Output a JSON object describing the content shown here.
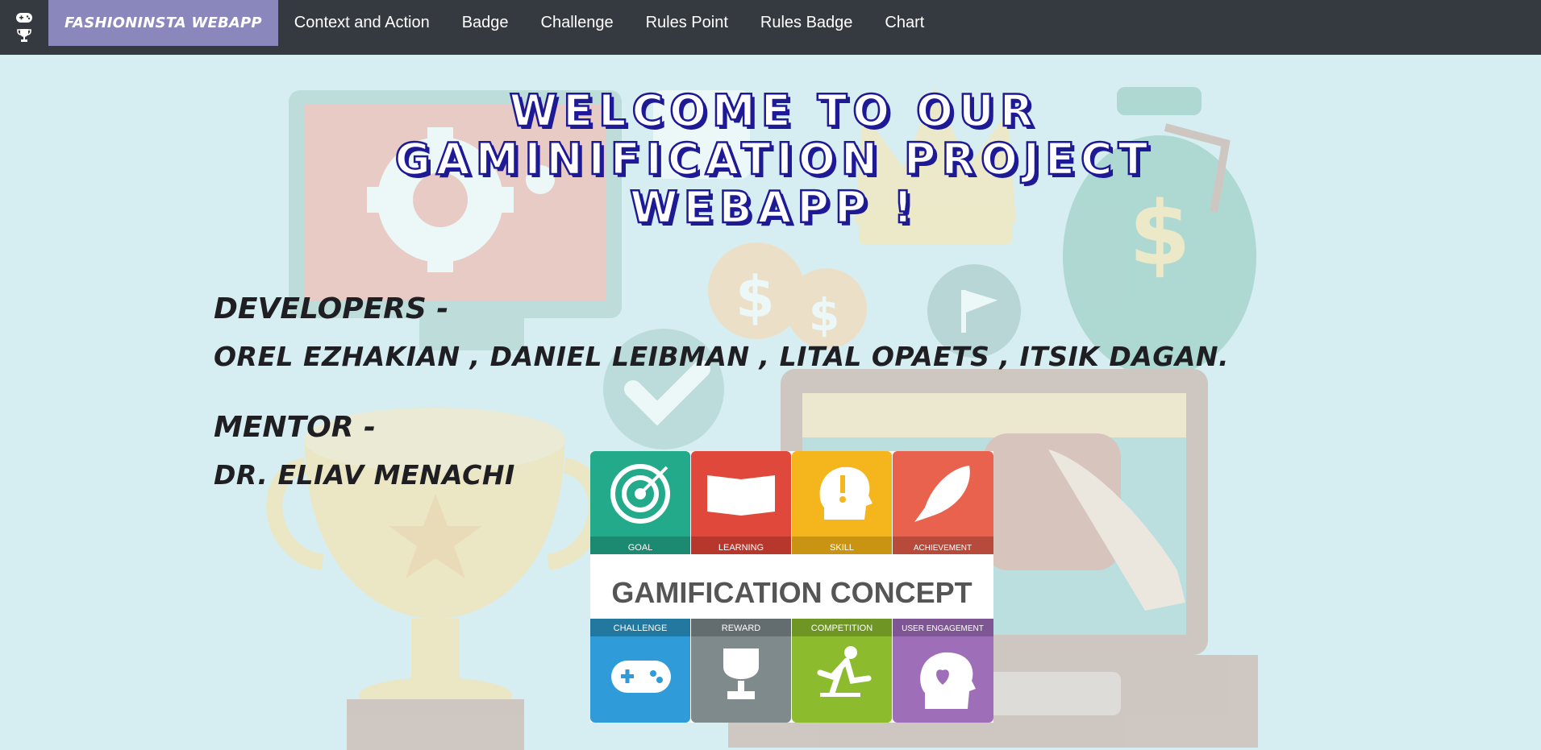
{
  "navbar": {
    "brand": "FASHIONINSTA WEBAPP",
    "icons": [
      "gamepad-icon",
      "trophy-icon"
    ],
    "links": [
      "Context and Action",
      "Badge",
      "Challenge",
      "Rules Point",
      "Rules Badge",
      "Chart"
    ]
  },
  "hero": {
    "title_line1": "WELCOME TO OUR",
    "title_line2": "GAMINIFICATION PROJECT",
    "title_line3": "WEBAPP !"
  },
  "credits": {
    "developers_heading": "DEVELOPERS -",
    "developers_names": "OREL EZHAKIAN , DANIEL LEIBMAN , LITAL OPAETS , ITSIK DAGAN.",
    "mentor_heading": "MENTOR -",
    "mentor_name": "DR. ELIAV MENACHI"
  },
  "concept_image": {
    "title": "GAMIFICATION CONCEPT",
    "top_tiles": [
      {
        "label": "GOAL",
        "color": "#22aa8b",
        "icon": "target-icon"
      },
      {
        "label": "LEARNING",
        "color": "#e0483c",
        "icon": "book-icon"
      },
      {
        "label": "SKILL",
        "color": "#f5b51d",
        "icon": "head-exclamation-icon"
      },
      {
        "label": "ACHIEVEMENT",
        "color": "#e8624e",
        "icon": "rocket-icon"
      }
    ],
    "bottom_tiles": [
      {
        "label": "CHALLENGE",
        "color": "#2f9cd9",
        "icon": "gamepad-icon"
      },
      {
        "label": "REWARD",
        "color": "#7f8a8c",
        "icon": "trophy-icon"
      },
      {
        "label": "COMPETITION",
        "color": "#8cbc2e",
        "icon": "runner-icon"
      },
      {
        "label": "USER ENGAGEMENT",
        "color": "#9e6fb8",
        "icon": "head-heart-icon"
      }
    ]
  },
  "colors": {
    "navbar_bg": "#343a40",
    "brand_bg": "#8a87bd",
    "page_bg": "#d6eef1",
    "title_outline": "#1e1a96"
  }
}
